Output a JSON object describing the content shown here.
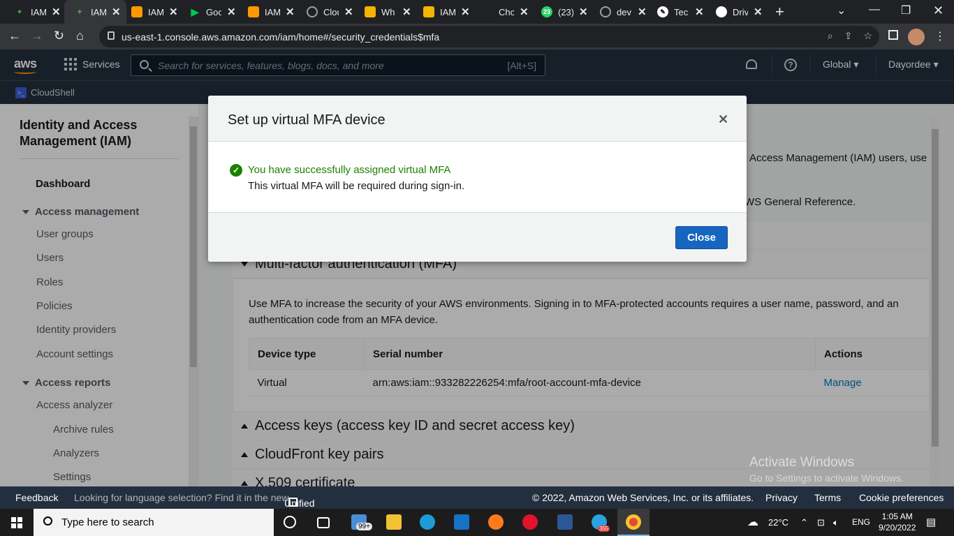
{
  "browser": {
    "tabs": [
      {
        "label": "IAM",
        "color": "#2e7d32",
        "glyph": "✦"
      },
      {
        "label": "IAM",
        "color": "#2e7d32",
        "glyph": "✦",
        "active": true
      },
      {
        "label": "IAM",
        "color": "#ff9900",
        "glyph": "⬢"
      },
      {
        "label": "Goo",
        "color": "#01875f",
        "glyph": "▶"
      },
      {
        "label": "IAM",
        "color": "#ff9900",
        "glyph": "⬢"
      },
      {
        "label": "Clou",
        "color": "#5f6368",
        "glyph": "◉"
      },
      {
        "label": "Wh",
        "color": "#f5b400",
        "glyph": "▣"
      },
      {
        "label": "IAM",
        "color": "#f5b400",
        "glyph": "▣"
      },
      {
        "label": "Cho",
        "color": "#202124",
        "glyph": ""
      },
      {
        "label": "(23)",
        "color": "#25d366",
        "glyph": "23"
      },
      {
        "label": "dev",
        "color": "#5f6368",
        "glyph": "◎"
      },
      {
        "label": "Tec",
        "color": "#ffffff",
        "glyph": "✎"
      },
      {
        "label": "Driv",
        "color": "#ffffff",
        "glyph": "◐"
      }
    ],
    "url": "us-east-1.console.aws.amazon.com/iam/home#/security_credentials$mfa"
  },
  "aws_header": {
    "logo": "aws",
    "services_label": "Services",
    "search_placeholder": "Search for services, features, blogs, docs, and more",
    "search_shortcut": "[Alt+S]",
    "region": "Global ▾",
    "account": "Dayordee ▾",
    "cloudshell": "CloudShell"
  },
  "sidebar": {
    "title": "Identity and Access Management (IAM)",
    "dashboard": "Dashboard",
    "access_management": "Access management",
    "am_items": [
      "User groups",
      "Users",
      "Roles",
      "Policies",
      "Identity providers",
      "Account settings"
    ],
    "access_reports": "Access reports",
    "ar_items": [
      "Access analyzer"
    ],
    "ar_sub_items": [
      "Archive rules",
      "Analyzers",
      "Settings"
    ]
  },
  "content": {
    "partial_text_1": "Access Management (IAM) users, use",
    "partial_text_2": "WS General Reference.",
    "mfa_section": "Multi-factor authentication (MFA)",
    "mfa_description": "Use MFA to increase the security of your AWS environments. Signing in to MFA-protected accounts requires a user name, password, and an authentication code from an MFA device.",
    "table_headers": [
      "Device type",
      "Serial number",
      "Actions"
    ],
    "table_row": {
      "device_type": "Virtual",
      "serial": "arn:aws:iam::933282226254:mfa/root-account-mfa-device",
      "action": "Manage"
    },
    "access_keys_section": "Access keys (access key ID and secret access key)",
    "cloudfront_section": "CloudFront key pairs",
    "x509_section": "X.509 certificate"
  },
  "modal": {
    "title": "Set up virtual MFA device",
    "success_title": "You have successfully assigned virtual MFA",
    "success_sub": "This virtual MFA will be required during sign-in.",
    "close_button": "Close"
  },
  "watermark": {
    "line1": "Activate Windows",
    "line2": "Go to Settings to activate Windows."
  },
  "footer": {
    "feedback": "Feedback",
    "language_text": "Looking for language selection? Find it in the new",
    "unified_settings": "Unified Settings",
    "copyright": "© 2022, Amazon Web Services, Inc. or its affiliates.",
    "privacy": "Privacy",
    "terms": "Terms",
    "cookies": "Cookie preferences"
  },
  "taskbar": {
    "search_placeholder": "Type here to search",
    "mail_badge": "99+",
    "telegram_badge": "355",
    "weather": "22°C",
    "language": "ENG",
    "time": "1:05 AM",
    "date": "9/20/2022"
  }
}
